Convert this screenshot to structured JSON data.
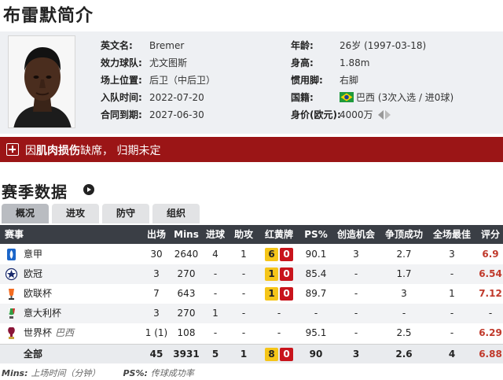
{
  "page_title": "布雷默简介",
  "profile": {
    "photo_alt": "player photo",
    "left": [
      {
        "label": "英文名:",
        "value": "Bremer"
      },
      {
        "label": "效力球队:",
        "value": "尤文图斯"
      },
      {
        "label": "场上位置:",
        "value": "后卫（中后卫）"
      },
      {
        "label": "入队时间:",
        "value": "2022-07-20"
      },
      {
        "label": "合同到期:",
        "value": "2027-06-30"
      }
    ],
    "right": [
      {
        "label": "年龄:",
        "value": "26岁  (1997-03-18)"
      },
      {
        "label": "身高:",
        "value": "1.88m"
      },
      {
        "label": "惯用脚:",
        "value": "右脚"
      },
      {
        "label": "国籍:",
        "value": "巴西 (3次入选 / 进0球)"
      },
      {
        "label": "身价(欧元):",
        "value": "4000万"
      }
    ],
    "nationality_flag": "brazil-flag-icon"
  },
  "injury": {
    "prefix": "因",
    "reason": "肌肉损伤",
    "suffix": "缺席，  归期未定"
  },
  "season": {
    "title": "赛季数据",
    "tabs": [
      "概况",
      "进攻",
      "防守",
      "组织"
    ],
    "headers": [
      "赛事",
      "出场",
      "Mins",
      "进球",
      "助攻",
      "红黄牌",
      "PS%",
      "创造机会",
      "争顶成功",
      "全场最佳",
      "评分"
    ],
    "rows": [
      {
        "comp": "意甲",
        "note": "",
        "apps": "30",
        "mins": "2640",
        "goals": "4",
        "assists": "1",
        "yellow": "6",
        "red": "0",
        "ps": "90.1",
        "chances": "3",
        "aerials": "2.7",
        "motm": "3",
        "rating": "6.9"
      },
      {
        "comp": "欧冠",
        "note": "",
        "apps": "3",
        "mins": "270",
        "goals": "-",
        "assists": "-",
        "yellow": "1",
        "red": "0",
        "ps": "85.4",
        "chances": "-",
        "aerials": "1.7",
        "motm": "-",
        "rating": "6.54"
      },
      {
        "comp": "欧联杯",
        "note": "",
        "apps": "7",
        "mins": "643",
        "goals": "-",
        "assists": "-",
        "yellow": "1",
        "red": "0",
        "ps": "89.7",
        "chances": "-",
        "aerials": "3",
        "motm": "1",
        "rating": "7.12"
      },
      {
        "comp": "意大利杯",
        "note": "",
        "apps": "3",
        "mins": "270",
        "goals": "1",
        "assists": "-",
        "yellow": "",
        "red": "",
        "cards_text": "-",
        "ps": "-",
        "chances": "-",
        "aerials": "-",
        "motm": "-",
        "rating": "-"
      },
      {
        "comp": "世界杯",
        "note": "巴西",
        "apps": "1 (1)",
        "mins": "108",
        "goals": "-",
        "assists": "-",
        "yellow": "",
        "red": "",
        "cards_text": "-",
        "ps": "95.1",
        "chances": "-",
        "aerials": "2.5",
        "motm": "-",
        "rating": "6.29"
      }
    ],
    "total": {
      "comp": "全部",
      "apps": "45",
      "mins": "3931",
      "goals": "5",
      "assists": "1",
      "yellow": "8",
      "red": "0",
      "ps": "90",
      "chances": "3",
      "aerials": "2.6",
      "motm": "4",
      "rating": "6.88"
    }
  },
  "footnote": {
    "mins_key": "Mins:",
    "mins_text": "上场时间（分钟）",
    "ps_key": "PS%:",
    "ps_text": "传球成功率"
  },
  "colors": {
    "injury_bar": "#9b1516",
    "table_header": "#3a3e45",
    "yellow_card": "#f5c518",
    "red_card": "#c8141c",
    "rating": "#c0392b"
  }
}
